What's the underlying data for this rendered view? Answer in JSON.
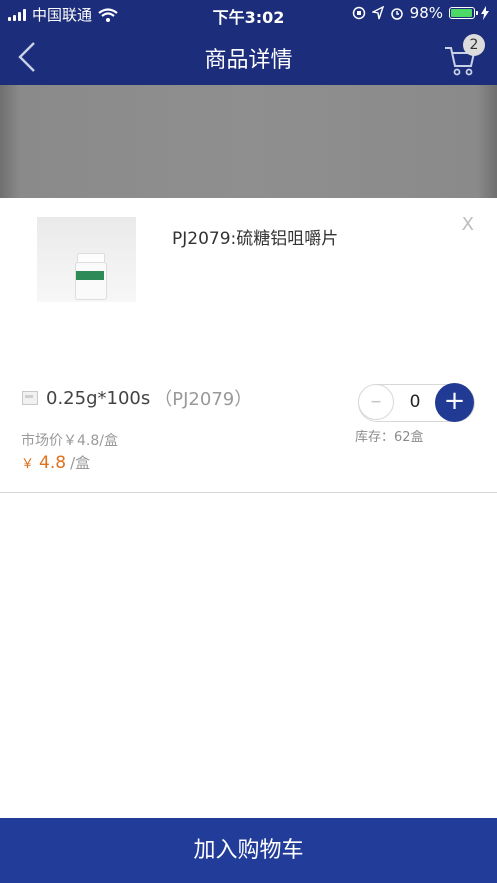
{
  "status_bar": {
    "carrier": "中国联通",
    "time": "下午3:02",
    "battery_text": "98%",
    "battery_level": 0.98
  },
  "nav": {
    "title": "商品详情",
    "cart_count": "2"
  },
  "product": {
    "name": "PJ2079:硫糖铝咀嚼片",
    "spec": "0.25g*100s",
    "spec_code": "（PJ2079）",
    "market_price_label": "市场价￥4.8/盒",
    "price_symbol": "￥",
    "price": "4.8",
    "price_unit": "/盒",
    "stock_label": "库存：62盒",
    "quantity": "0"
  },
  "actions": {
    "close": "X",
    "minus": "–",
    "plus": "+",
    "add_to_cart": "加入购物车"
  },
  "colors": {
    "nav_bg": "#1c2e7b",
    "accent": "#213a93",
    "price": "#e0711d"
  }
}
